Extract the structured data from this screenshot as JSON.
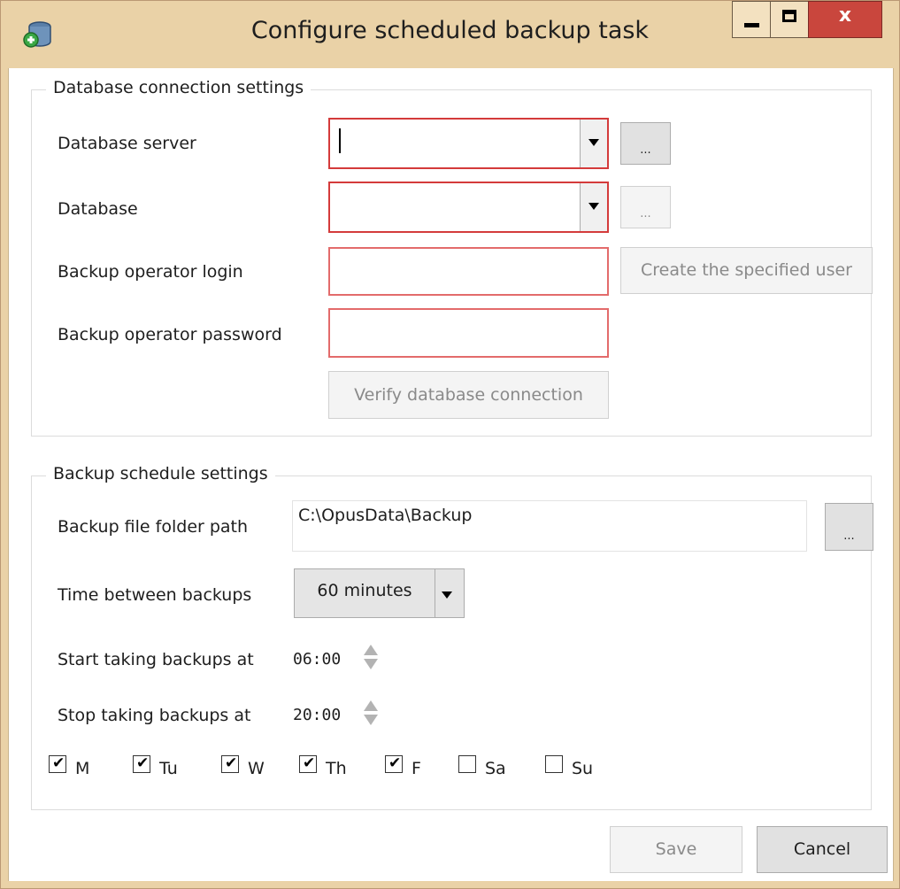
{
  "window": {
    "title": "Configure scheduled backup task",
    "icon": "database-add-icon",
    "controls": {
      "minimize": "minimize-icon",
      "maximize": "maximize-icon",
      "close_label": "x"
    }
  },
  "db_group": {
    "legend": "Database connection settings",
    "server_label": "Database server",
    "server_value": "",
    "server_browse": "...",
    "database_label": "Database",
    "database_value": "",
    "database_browse": "...",
    "login_label": "Backup operator login",
    "login_value": "",
    "create_user": "Create the specified user",
    "password_label": "Backup operator password",
    "password_value": "",
    "verify": "Verify database connection"
  },
  "schedule_group": {
    "legend": "Backup schedule settings",
    "folder_label": "Backup file folder path",
    "folder_value": "C:\\OpusData\\Backup",
    "folder_browse": "...",
    "interval_label": "Time between backups",
    "interval_value": "60 minutes",
    "start_label": "Start taking backups at",
    "start_value": "06:00",
    "stop_label": "Stop taking backups at",
    "stop_value": "20:00",
    "days": [
      {
        "label": "M",
        "checked": true
      },
      {
        "label": "Tu",
        "checked": true
      },
      {
        "label": "W",
        "checked": true
      },
      {
        "label": "Th",
        "checked": true
      },
      {
        "label": "F",
        "checked": true
      },
      {
        "label": "Sa",
        "checked": false
      },
      {
        "label": "Su",
        "checked": false
      }
    ]
  },
  "footer": {
    "save": "Save",
    "cancel": "Cancel"
  },
  "colors": {
    "title_bar": "#ead2a7",
    "close_button": "#c9463d",
    "invalid_border": "#d43b3b"
  }
}
